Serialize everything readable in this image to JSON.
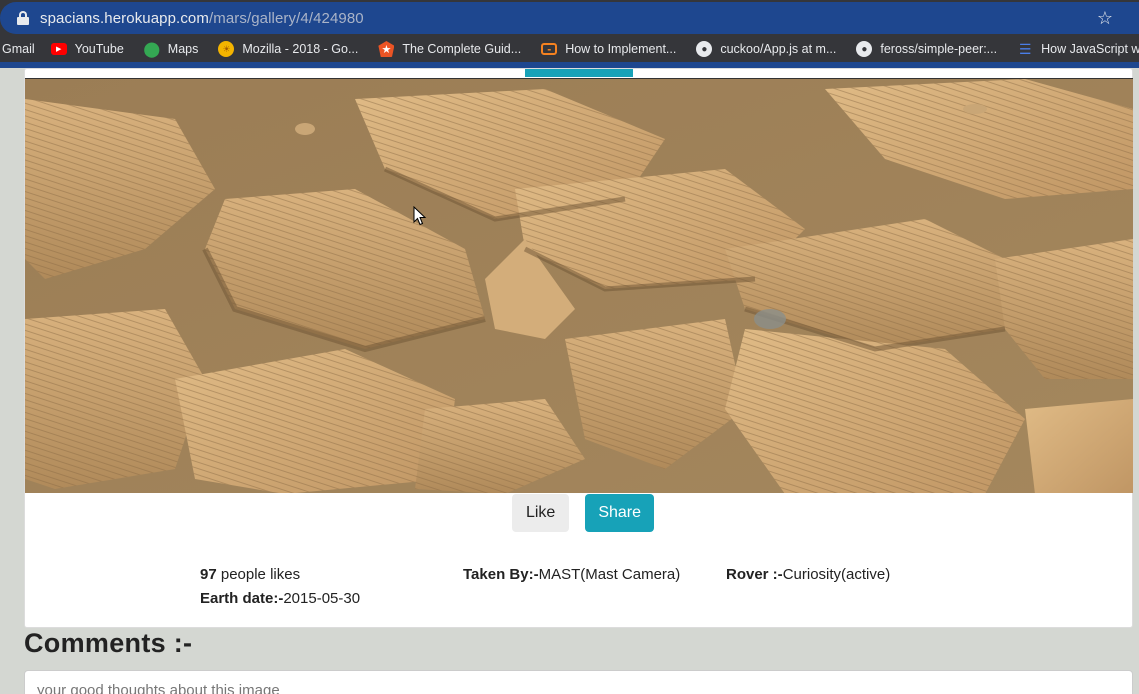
{
  "browser": {
    "url_host": "spacians.herokuapp.com",
    "url_path": "/mars/gallery/4/424980",
    "bookmarks": [
      {
        "label": "Gmail",
        "icon": "gmail-icon"
      },
      {
        "label": "YouTube",
        "icon": "youtube-icon"
      },
      {
        "label": "Maps",
        "icon": "maps-icon"
      },
      {
        "label": "Mozilla - 2018 - Go...",
        "icon": "mozilla-icon"
      },
      {
        "label": "The Complete Guid...",
        "icon": "auth0-icon"
      },
      {
        "label": "How to Implement...",
        "icon": "code-icon"
      },
      {
        "label": "cuckoo/App.js at m...",
        "icon": "github-icon"
      },
      {
        "label": "feross/simple-peer:...",
        "icon": "github-icon"
      },
      {
        "label": "How JavaScript wor...",
        "icon": "bookmark-page-icon"
      }
    ]
  },
  "actions": {
    "like_label": "Like",
    "share_label": "Share"
  },
  "info": {
    "likes_count": "97",
    "likes_suffix": " people likes",
    "earth_date_label": "Earth date:-",
    "earth_date_value": "2015-05-30",
    "taken_by_label": "Taken By:-",
    "taken_by_value": "MAST(Mast Camera)",
    "rover_label": "Rover :-",
    "rover_value": "Curiosity(active)"
  },
  "comments": {
    "title": "Comments :-",
    "placeholder": "your good thoughts about this image"
  },
  "colors": {
    "accent": "#17a2b8",
    "address_bar": "#1e478f",
    "chrome": "#35363a"
  }
}
